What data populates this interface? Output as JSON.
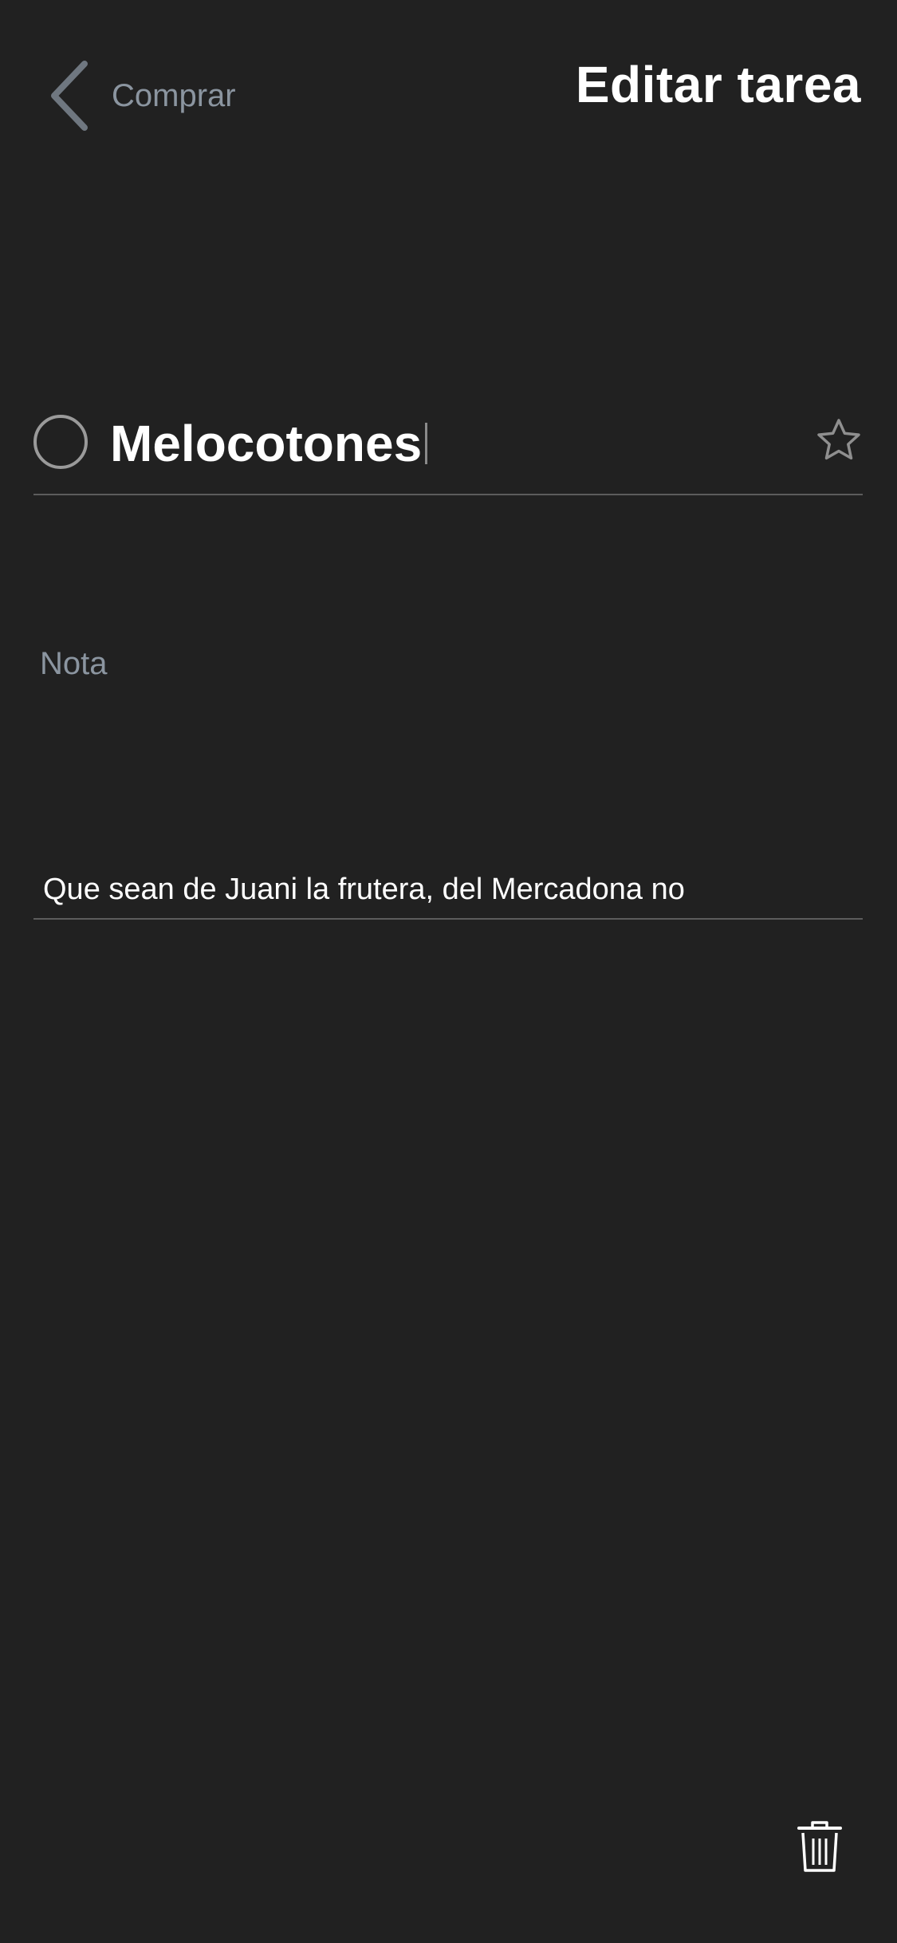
{
  "header": {
    "back_label": "Comprar",
    "title": "Editar tarea"
  },
  "task": {
    "title": "Melocotones",
    "completed": false,
    "starred": false
  },
  "note": {
    "label": "Nota",
    "text": "Que sean de Juani la frutera, del Mercadona no"
  },
  "icons": {
    "back": "chevron-left-icon",
    "check": "circle-outline-icon",
    "star": "star-outline-icon",
    "delete": "trash-icon"
  },
  "colors": {
    "background": "#212121",
    "muted_text": "#8b95a0",
    "primary_text": "#ffffff",
    "divider": "#5c5c5c"
  }
}
